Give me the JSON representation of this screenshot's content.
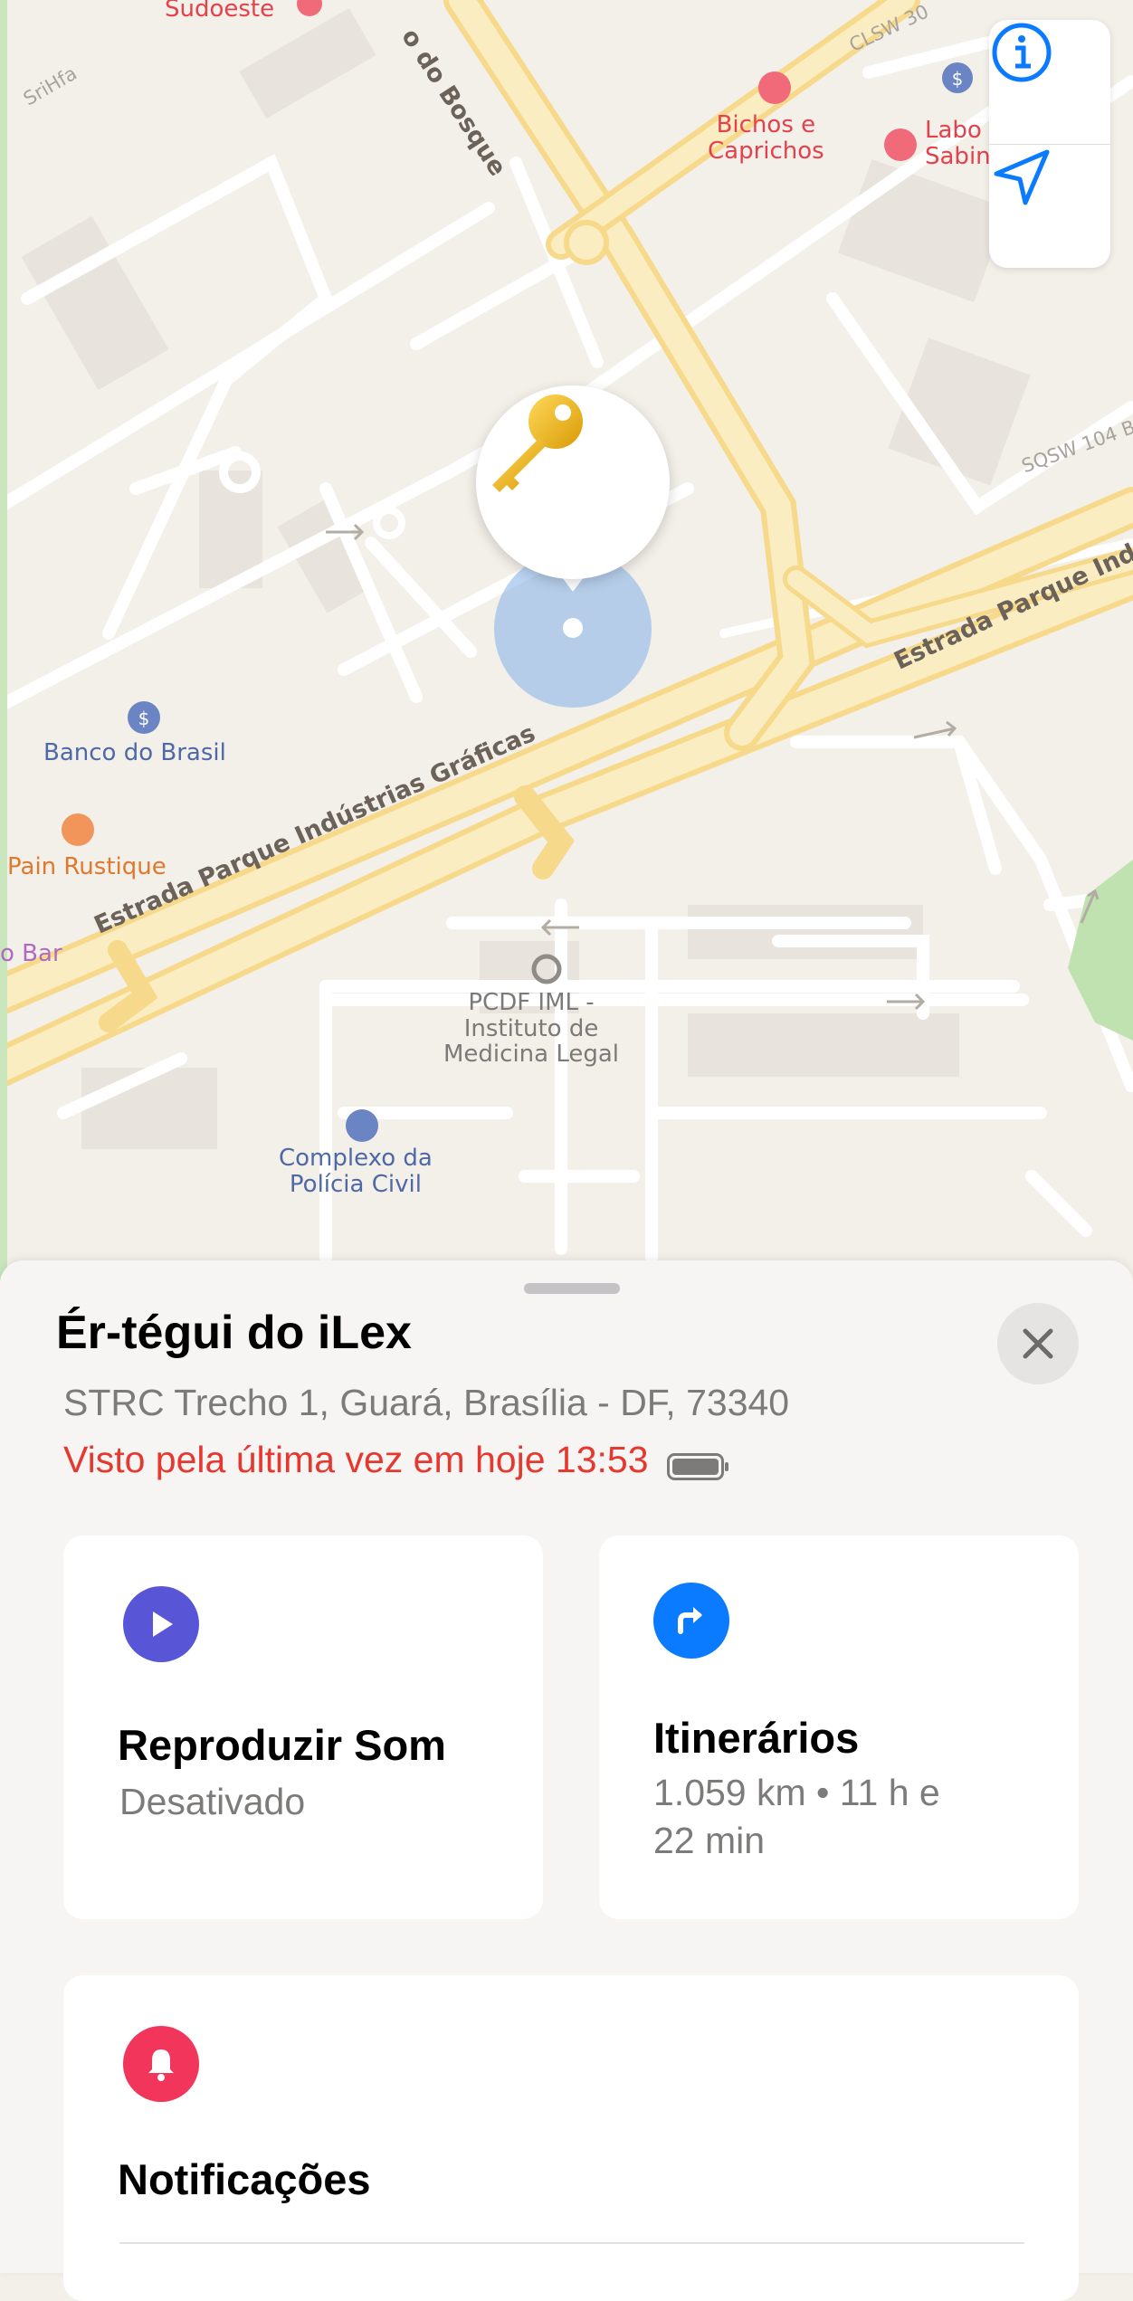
{
  "map": {
    "labels": {
      "sudoeste": "Sudoeste",
      "srihfa": "SriHfa",
      "bosque": "o do Bosque",
      "clsw": "CLSW 30",
      "bichos": "Bichos e\nCaprichos",
      "labo": "Labo\nSabin",
      "sqsw": "SQSW 104 B",
      "estrada_ind": "Estrada Parque Indú",
      "banco": "Banco do Brasil",
      "pain": "Pain Rustique",
      "graficas": "Estrada Parque Indústrias Gráficas",
      "bar": "o Bar",
      "pcdf": "PCDF IML -\nInstituto de\nMedicina Legal",
      "policia": "Complexo da\nPolícia Civil"
    },
    "controls": {
      "info_icon": "info-icon",
      "location_icon": "location-arrow-icon"
    },
    "pin": {
      "icon": "key-icon",
      "accent": "#f0b615"
    }
  },
  "sheet": {
    "title": "Ér-tégui do iLex",
    "address": "STRC Trecho 1, Guará, Brasília - DF, 73340",
    "last_seen": "Visto pela última vez em hoje 13:53",
    "last_seen_color": "#e5382f",
    "cards": {
      "sound": {
        "title": "Reproduzir Som",
        "subtitle": "Desativado",
        "icon": "play-icon",
        "icon_color": "#5856d6"
      },
      "directions": {
        "title": "Itinerários",
        "subtitle": "1.059 km • 11 h e\n22 min",
        "icon": "turn-right-arrow-icon",
        "icon_color": "#0a7aff"
      },
      "notifications": {
        "title": "Notificações",
        "icon": "bell-icon",
        "icon_color": "#f2355a"
      }
    }
  }
}
